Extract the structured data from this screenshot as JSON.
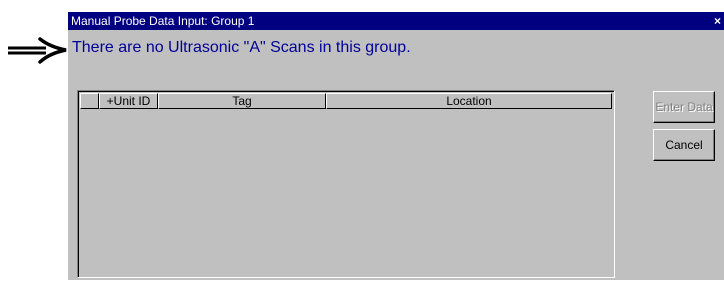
{
  "window": {
    "title": "Manual Probe Data Input: Group 1",
    "close_glyph": "×"
  },
  "message": "There are no Ultrasonic \"A\" Scans in this group.",
  "annotation": {
    "icon": "right-arrow-icon"
  },
  "grid": {
    "columns": [
      "",
      "+Unit ID",
      "Tag",
      "Location"
    ],
    "rows": []
  },
  "buttons": {
    "enter_data": "Enter Data",
    "enter_data_enabled": false,
    "cancel": "Cancel"
  },
  "colors": {
    "title_bar": "#000080",
    "message_text": "#00009a",
    "window_face": "#c0c0c0"
  }
}
